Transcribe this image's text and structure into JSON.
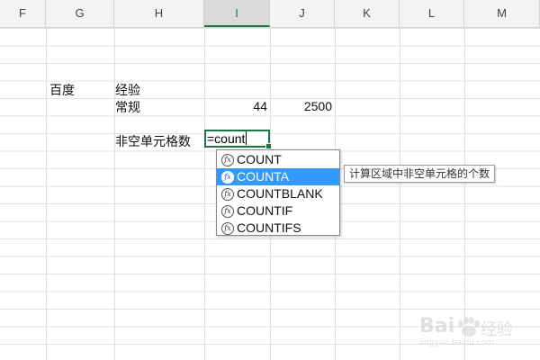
{
  "columns": [
    {
      "label": "F",
      "selected": false
    },
    {
      "label": "G",
      "selected": false
    },
    {
      "label": "H",
      "selected": false
    },
    {
      "label": "I",
      "selected": true
    },
    {
      "label": "J",
      "selected": false
    },
    {
      "label": "K",
      "selected": false
    },
    {
      "label": "L",
      "selected": false
    },
    {
      "label": "M",
      "selected": false
    }
  ],
  "cells": {
    "g_baidu": "百度",
    "h_jingyan": "经验",
    "h_changgui": "常规",
    "i_value": "44",
    "j_value": "2500",
    "h_label": "非空单元格数"
  },
  "active_cell": {
    "formula": "=count"
  },
  "autocomplete": {
    "items": [
      "COUNT",
      "COUNTA",
      "COUNTBLANK",
      "COUNTIF",
      "COUNTIFS"
    ],
    "selected_index": 1,
    "icon": "fx-function-icon"
  },
  "tooltip": {
    "text": "计算区域中非空单元格的个数"
  },
  "watermark": {
    "brand": "Bai",
    "product": "经验",
    "url": "jingyan.baidu.com"
  },
  "colors": {
    "accent": "#217346",
    "selection": "#3399ff"
  }
}
